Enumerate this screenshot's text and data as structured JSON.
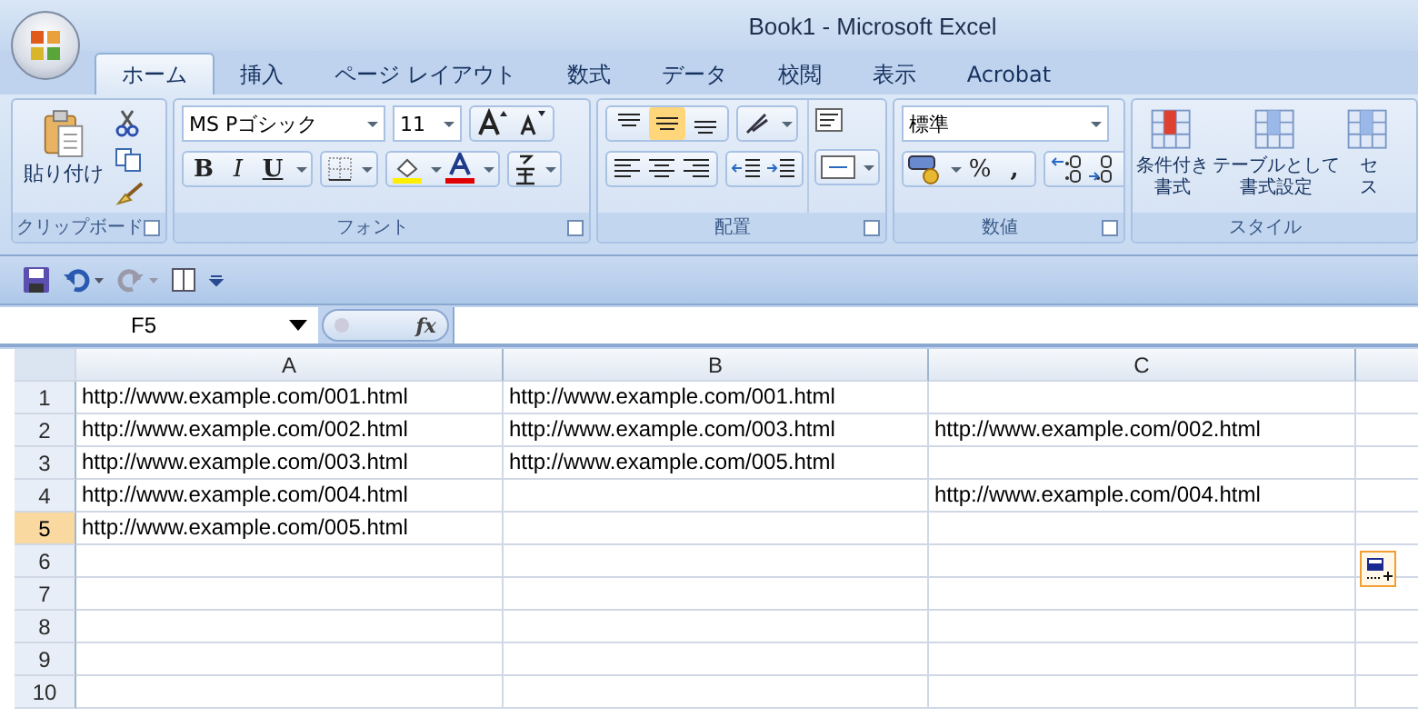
{
  "window": {
    "title": "Book1 - Microsoft Excel"
  },
  "tabs": [
    {
      "label": "ホーム",
      "selected": true
    },
    {
      "label": "挿入",
      "selected": false
    },
    {
      "label": "ページ レイアウト",
      "selected": false
    },
    {
      "label": "数式",
      "selected": false
    },
    {
      "label": "データ",
      "selected": false
    },
    {
      "label": "校閲",
      "selected": false
    },
    {
      "label": "表示",
      "selected": false
    },
    {
      "label": "Acrobat",
      "selected": false
    }
  ],
  "ribbon": {
    "clipboard": {
      "label": "クリップボード",
      "paste": "貼り付け"
    },
    "font": {
      "label": "フォント",
      "name": "MS Pゴシック",
      "size": "11",
      "bold": "B",
      "italic": "I",
      "underline": "U"
    },
    "alignment": {
      "label": "配置",
      "vertical_align": [
        {
          "selected": false
        },
        {
          "selected": true
        },
        {
          "selected": false
        }
      ]
    },
    "number": {
      "label": "数値",
      "format": "標準",
      "percent": "%",
      "comma": ","
    },
    "styles": {
      "label": "スタイル",
      "buttons": [
        {
          "lines": [
            "条件付き",
            "書式"
          ]
        },
        {
          "lines": [
            "テーブルとして",
            "書式設定"
          ]
        },
        {
          "lines": [
            "セ",
            "ス"
          ]
        }
      ]
    }
  },
  "name_box": "F5",
  "formula_label": "fx",
  "columns": [
    "A",
    "B",
    "C"
  ],
  "rows": [
    {
      "header": "1",
      "selected": false,
      "cells": [
        "http://www.example.com/001.html",
        "http://www.example.com/001.html",
        null
      ]
    },
    {
      "header": "2",
      "selected": false,
      "cells": [
        "http://www.example.com/002.html",
        "http://www.example.com/003.html",
        "http://www.example.com/002.html"
      ]
    },
    {
      "header": "3",
      "selected": false,
      "cells": [
        "http://www.example.com/003.html",
        "http://www.example.com/005.html",
        null
      ]
    },
    {
      "header": "4",
      "selected": false,
      "cells": [
        "http://www.example.com/004.html",
        null,
        "http://www.example.com/004.html"
      ]
    },
    {
      "header": "5",
      "selected": true,
      "cells": [
        "http://www.example.com/005.html",
        null,
        null
      ]
    },
    {
      "header": "6",
      "selected": false,
      "cells": [
        null,
        null,
        null
      ]
    },
    {
      "header": "7",
      "selected": false,
      "cells": [
        null,
        null,
        null
      ]
    },
    {
      "header": "8",
      "selected": false,
      "cells": [
        null,
        null,
        null
      ]
    },
    {
      "header": "9",
      "selected": false,
      "cells": [
        null,
        null,
        null
      ]
    },
    {
      "header": "10",
      "selected": false,
      "cells": [
        null,
        null,
        null
      ]
    }
  ]
}
